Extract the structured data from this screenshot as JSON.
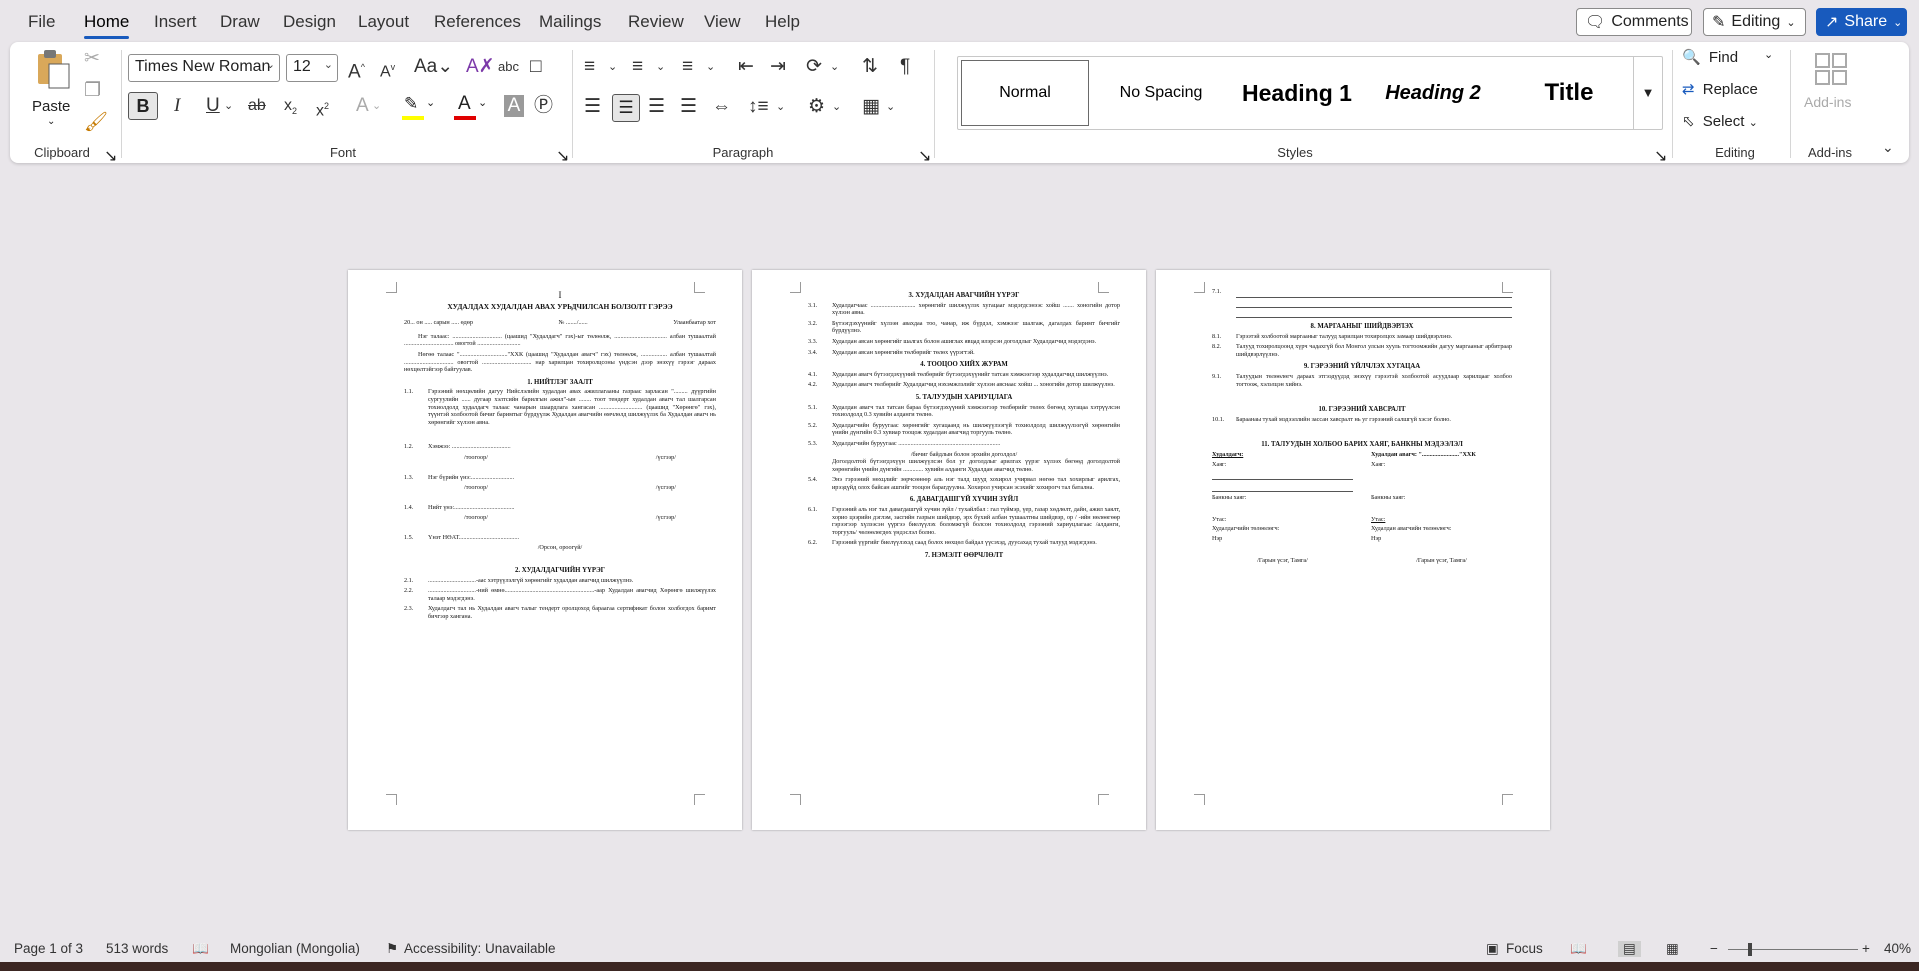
{
  "menu": {
    "tabs": [
      "File",
      "Home",
      "Insert",
      "Draw",
      "Design",
      "Layout",
      "References",
      "Mailings",
      "Review",
      "View",
      "Help"
    ],
    "comments_label": "Comments",
    "editing_label": "Editing",
    "share_label": "Share"
  },
  "ribbon": {
    "clipboard": {
      "paste_label": "Paste",
      "group_label": "Clipboard"
    },
    "font": {
      "font_name": "Times New Roman",
      "font_size": "12",
      "group_label": "Font",
      "highlight_color": "#ffff00",
      "font_color": "#e00000"
    },
    "paragraph": {
      "group_label": "Paragraph"
    },
    "styles": {
      "items": [
        "Normal",
        "No Spacing",
        "Heading 1",
        "Heading 2",
        "Title"
      ],
      "group_label": "Styles"
    },
    "editing": {
      "find_label": "Find",
      "replace_label": "Replace",
      "select_label": "Select",
      "group_label": "Editing"
    },
    "addins": {
      "addins_label": "Add-ins",
      "group_label": "Add-ins"
    }
  },
  "pages": {
    "p1": {
      "marker": "I",
      "title": "ХУДАЛДАХ ХУДАЛДАН АВАХ УРЬДЧИЛСАН БОЛЗОЛТ ГЭРЭЭ",
      "date_line": [
        "20... он ..... сарын ..... өдөр",
        "№ ......./......",
        "Улаанбаатар хот"
      ],
      "intro1": "Нэг талаас: ................................ (цаашид \"Худалдагч\" гэх)-ыг төлөөлж, .................................. албан тушаалтай ................................ овогтой ............................",
      "intro2": "Нөгөө талаас \"...............................\"ХХК (цаашид \"Худалдан авагч\" гэх) төлөөлж, ................. албан тушаалтай ................................ овогтой ................................ нар харилцан тохиролцсоны үндсэн дээр энэхүү гэрээг дараах нөхцөлтэйгээр байгуулав.",
      "s1": "1. НИЙТЛЭГ ЗААЛТ",
      "i1_1": "Гэрээний нөхцөлийн дагуу Нийслэлийн худалдан авах ажиллагааны газраас зарласан \"......... дүүргийн сургуулийн ...... дугаар хэлтсийн барилгын ажил\"-ын ........ тоот тендерт худалдан авагч тал шалгарсан тохиолдолд худалдагч талаас чанарын шаардлага хангасан ............................ (цаашид \"Хөрөнгө\" гэх), түүнтэй холбоотой бичиг баримтыг бүрдүүлж Худалдан авагчийн өмчлөлд шилжүүлэх ба Худалдан авагч нь хөрөнгийг хүлээн авна.",
      "i1_2": "Хэмжээ: ......................................",
      "i1_3": "Нэг бүрийн үнэ:............................",
      "i1_4": "Нийт үнэ:.......................................",
      "i1_5": "Үнэт НӨАТ.......................................",
      "num_label": "/тоогоор/",
      "word_label": "/үсгээр/",
      "vat_label": "/Орсон, ороогүй/",
      "s2": "2. ХУДАЛДАГЧИЙН ҮҮРЭГ",
      "i2_1": "...............................-ааc хэтрүүлэлгүй хөрөнгийг худалдан авагчид шилжүүлнэ.",
      "i2_2": "...............................-ний өмнө..........................................................-аар Худалдан авагчид Хөрөнгө шилжүүлэх талаар мэдэгдэнэ.",
      "i2_3": "Худалдагч тал нь Худалдан авагч талыг тендерт оролцоход бараагаа сертификат болон холбогдох баримт бичгээр хангана."
    },
    "p2": {
      "s3": "3. ХУДАЛДАН АВАГЧИЙН ҮҮРЭГ",
      "i3_1": "Худалдагчаас ............................. хөрөнгийг шилжүүлэх хугацааг мэдэгдсэнээс хойш ....... хоногийн дотор хүлээн авна.",
      "i3_2": "Бүтээгдэхүүнийг хүлээн авахдаа тоо, чанар, иж бүрдэл, хэмжээг шалгаж, дагалдах баримт бичгийг бүрдүүлнэ.",
      "i3_3": "Худалдан авсан хөрөнгийг шалгах болон ашиглах явцад илэрсэн доголдлыг Худалдагчид мэдэгдэнэ.",
      "i3_4": "Худалдан авсан хөрөнгийн төлбөрийг төлөх үүрэгтэй.",
      "s4": "4. ТООЦОО ХИЙХ ЖУРАМ",
      "i4_1": "Худалдан авагч бүтээгдэхүүний төлбөрийг бүтээгдэхүүнийг татсан хэмжээгээр худалдагчид шилжүүлнэ.",
      "i4_2": "Худалдан авагч төлбөрийг Худалдагчид нэхэмжлэлийг хүлээн авснаас хойш ... хоногийн дотор шилжүүлнэ.",
      "s5": "5. ТАЛУУДЫН ХАРИУЦЛАГА",
      "i5_1": "Худалдан авагч тал татсан бараа бүтээгдэхүүний хэмжээгээр төлбөрийг төлөх бөгөөд хугацаа хэтрүүлсэн тохиолдолд 0.3 хувийн алданги төлнө.",
      "i5_2": "Худалдагчийн буруугаас хөрөнгийг хугацаанд нь шилжүүлээгүй тохиолдолд шилжүүлээгүй хөрөнгийн үнийн дүнгийн 0.3 хувиар тооцож худалдан авагчид торгууль төлнө.",
      "i5_3": "Худалдагчийн буруугаас ..................................................................",
      "i5_3b": "/бичиг байдлын болон эрхийн доголдол/",
      "i5_3c": "Доголдолтой бүтээгдэхүүн шилжүүлсэн бол уг доголдлыг арилгах үүрэг хүлээх бөгөөд доголдолтой хөрөнгийн үнийн дүнгийн ............. хувийн алданги Худалдан авагчид төлнө.",
      "i5_4": "Энэ гэрээний нөхцлийг зөрчсөнөөр аль нэг талд шууд хохирол учирвал нөгөө тал хохирлыг арилгах, ирээдүйд олох байсан ашгийг тооцон барагдуулна. Хохирол учирсан эсэхийг хохирогч тал батална.",
      "s6": "6. ДАВАГДАШГҮЙ ХҮЧИН ЗҮЙЛ",
      "i6_1": "Гэрээний аль нэг тал давагдашгүй хүчин зүйл / тухайлбал : гал түймэр, үер, газар хөдлөлт, дайн, ажил хаялт, хорио цээрийн дэглэм, засгийн газрын шийдвэр, эрх бүхий албан тушаалтны шийдвэр, ор / -ийн нөлөөгөөр гэрээгээр хүлээсэн үүргээ биелүүлэх боломжгүй болсон тохиолдолд гэрээний хариуцлагаас /алданги, торгууль/ чөлөөлөгдөх үндэслэл болно.",
      "i6_2": "Гэрээний үүргийг биелүүлэхэд саад болох нөхцөл байдал үүсэхэд, дуусахад тухай талууд мэдэгдэнэ.",
      "s7": "7. НЭМЭЛТ ӨӨРЧЛӨЛТ"
    },
    "p3": {
      "s8": "8. МАРГААНЫГ ШИЙДВЭРЛЭХ",
      "i8_1": "Гэрээтэй холбоотой маргааныг талууд харилцан тохиролцох замаар шийдвэрлэнэ.",
      "i8_2": "Талууд тохиролцоонд хүрч чадахгүй бол Монгол улсын хууль тогтоомжийн дагуу маргааныг арбитраар шийдвэрлүүлнэ.",
      "s9": "9. ГЭРЭЭНИЙ ҮЙЛЧЛЭХ ХУГАЦАА",
      "i9_1": "Талуудын төлөөлөгч дараах этгээдүүдэд энэхүү гэрээтэй холбоотой асуудлаар харилцааг холбоо тогтоож, хэлэлцэн хийнэ.",
      "s10": "10. ГЭРЭЭНИЙ ХАВСРАЛТ",
      "i10_1": "Бараанаы тухай мэдээллийн зассан хавсралт нь уг гэрээний салшгүй хэсэг болно.",
      "s11": "11. ТАЛУУДЫН ХОЛБОО БАРИХ ХАЯГ, БАНКНЫ МЭДЭЭЛЭЛ",
      "seller": "Худалдагч:",
      "buyer": "Худалдан авагч: \"........................\"ХХК",
      "address": "Хаяг:",
      "bank": "Банкны хаяг:",
      "phone": "Утас:",
      "seller_rep": "Худалдагчийн төлөөлөгч:",
      "buyer_rep": "Худалдан авагчийн төлөөлөгч:",
      "name": "Нэр",
      "sign": "/Гарын үсэг, Тамга/"
    }
  },
  "status": {
    "page": "Page 1 of 3",
    "words": "513 words",
    "language": "Mongolian (Mongolia)",
    "accessibility": "Accessibility: Unavailable",
    "focus": "Focus",
    "zoom": "40%"
  }
}
